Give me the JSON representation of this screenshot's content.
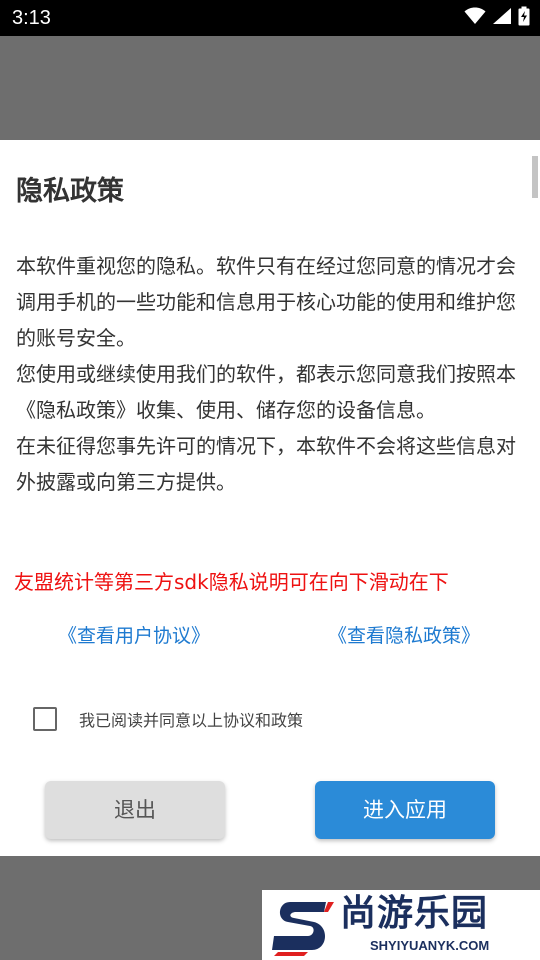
{
  "status_bar": {
    "time": "3:13",
    "icons": [
      "wifi-icon",
      "cellular-signal-icon",
      "battery-charging-icon"
    ]
  },
  "dialog": {
    "title": "隐私政策",
    "paragraphs": [
      "本软件重视您的隐私。软件只有在经过您同意的情况才会调用手机的一些功能和信息用于核心功能的使用和维护您的账号安全。",
      "您使用或继续使用我们的软件，都表示您同意我们按照本《隐私政策》收集、使用、储存您的设备信息。",
      "在未征得您事先许可的情况下，本软件不会将这些信息对外披露或向第三方提供。"
    ],
    "sdk_note": "友盟统计等第三方sdk隐私说明可在向下滑动在下",
    "links": {
      "user_agreement": "《查看用户协议》",
      "privacy_policy": "《查看隐私政策》"
    },
    "agree": {
      "label": "我已阅读并同意以上协议和政策",
      "checked": false
    },
    "buttons": {
      "exit": "退出",
      "enter": "进入应用"
    }
  },
  "watermark": {
    "name_cn": "尚游乐园",
    "domain": "SHYIYUANYK.COM"
  },
  "colors": {
    "accent_blue": "#2b8bd8",
    "link_blue": "#1e7ad0",
    "warning_red": "#ee1111",
    "overlay_gray": "#6e6e6e"
  }
}
